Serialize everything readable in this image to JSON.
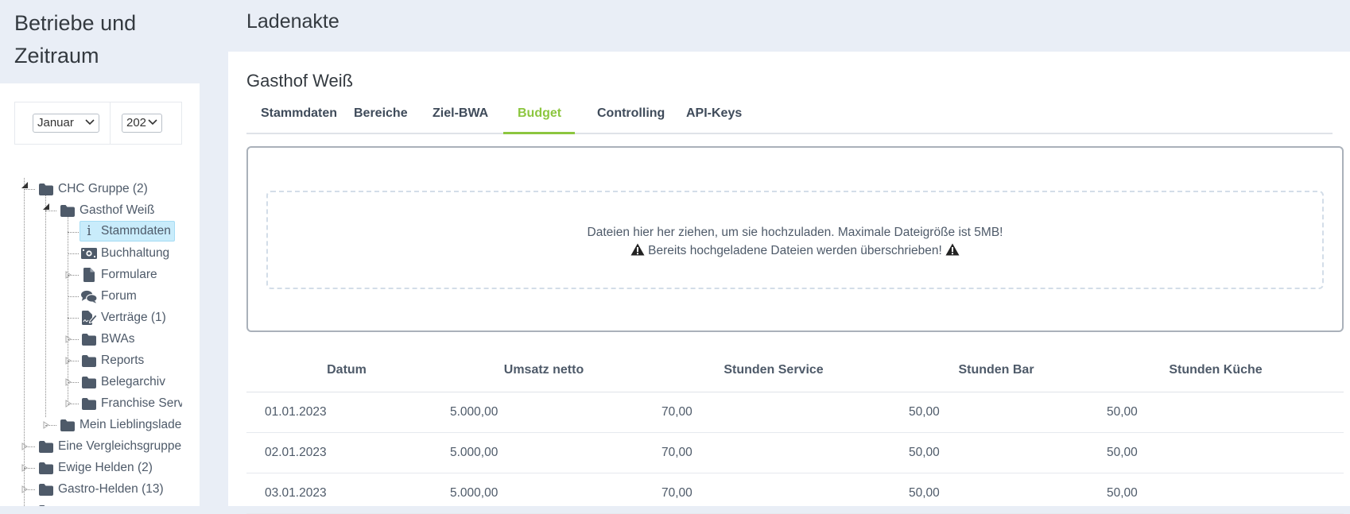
{
  "sidebar": {
    "title": "Betriebe und Zeitraum",
    "period": {
      "month": "Januar",
      "year": "202"
    },
    "tree": [
      {
        "label": "CHC Gruppe (2)",
        "icon": "folder-icon"
      },
      {
        "label": "Gasthof Weiß",
        "icon": "folder-icon"
      },
      {
        "label": "Stammdaten",
        "icon": "info-icon"
      },
      {
        "label": "Buchhaltung",
        "icon": "money-icon"
      },
      {
        "label": "Formulare",
        "icon": "file-icon"
      },
      {
        "label": "Forum",
        "icon": "comments-icon"
      },
      {
        "label": "Verträge (1)",
        "icon": "contract-icon"
      },
      {
        "label": "BWAs",
        "icon": "folder-icon"
      },
      {
        "label": "Reports",
        "icon": "folder-icon"
      },
      {
        "label": "Belegarchiv",
        "icon": "folder-icon"
      },
      {
        "label": "Franchise Serv",
        "icon": "folder-icon"
      },
      {
        "label": "Mein Lieblingslade",
        "icon": "folder-icon"
      },
      {
        "label": "Eine Vergleichsgruppe",
        "icon": "folder-icon"
      },
      {
        "label": "Ewige Helden (2)",
        "icon": "folder-icon"
      },
      {
        "label": "Gastro-Helden (13)",
        "icon": "folder-icon"
      }
    ]
  },
  "header": {
    "title": "Ladenakte"
  },
  "main": {
    "shop_name": "Gasthof Weiß",
    "tabs": [
      {
        "label": "Stammdaten"
      },
      {
        "label": "Bereiche"
      },
      {
        "label": "Ziel-BWA"
      },
      {
        "label": "Budget"
      },
      {
        "label": "Controlling"
      },
      {
        "label": "API-Keys"
      }
    ],
    "active_tab": "Budget",
    "upload": {
      "line1": "Dateien hier her ziehen, um sie hochzuladen. Maximale Dateigröße ist 5MB!",
      "line2": "Bereits hochgeladene Dateien werden überschrieben!"
    },
    "table": {
      "headers": [
        "Datum",
        "Umsatz netto",
        "Stunden Service",
        "Stunden Bar",
        "Stunden Küche"
      ],
      "rows": [
        [
          "01.01.2023",
          "5.000,00",
          "70,00",
          "50,00",
          "50,00"
        ],
        [
          "02.01.2023",
          "5.000,00",
          "70,00",
          "50,00",
          "50,00"
        ],
        [
          "03.01.2023",
          "5.000,00",
          "70,00",
          "50,00",
          "50,00"
        ]
      ]
    }
  },
  "colors": {
    "accent": "#8cc63f",
    "header_bg": "#e9eef6",
    "selected_bg": "#c9ecfb",
    "icon": "#4e5a69"
  }
}
